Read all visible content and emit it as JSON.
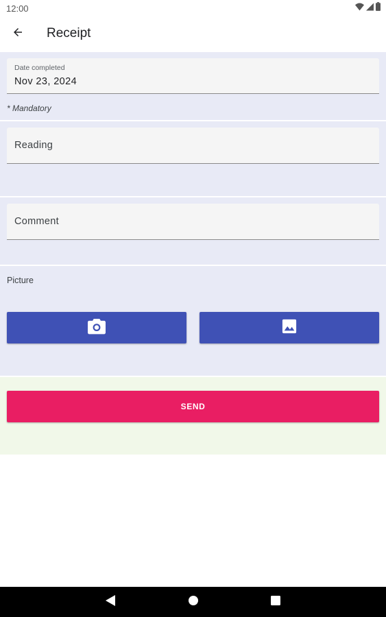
{
  "status_bar": {
    "time": "12:00",
    "icons": [
      "wifi-icon",
      "signal-icon",
      "battery-icon"
    ]
  },
  "app_bar": {
    "title": "Receipt",
    "back_icon": "arrow-back-icon"
  },
  "form": {
    "date_field": {
      "label": "Date completed",
      "value": "Nov 23, 2024"
    },
    "mandatory_note": "* Mandatory",
    "reading_field": {
      "placeholder": "Reading",
      "value": ""
    },
    "comment_field": {
      "placeholder": "Comment",
      "value": ""
    },
    "picture": {
      "label": "Picture",
      "camera_icon": "camera-icon",
      "gallery_icon": "image-icon"
    },
    "send_label": "SEND"
  },
  "nav_bar": {
    "icons": [
      "nav-back-icon",
      "nav-home-icon",
      "nav-recents-icon"
    ]
  },
  "colors": {
    "section_bg": "#e8eaf6",
    "send_section_bg": "#f1f8e9",
    "primary": "#3f51b5",
    "accent": "#e91e63",
    "field_bg": "#f5f5f5"
  }
}
